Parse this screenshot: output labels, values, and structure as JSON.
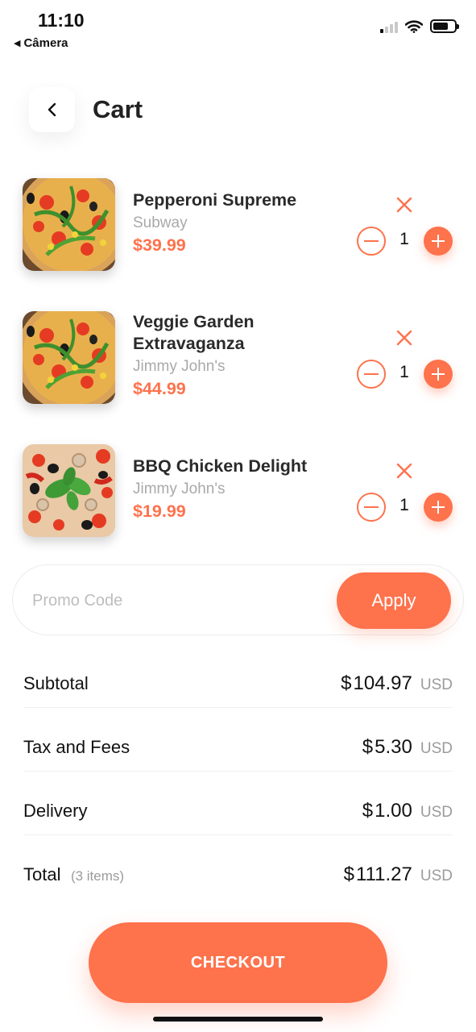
{
  "status_bar": {
    "time": "11:10",
    "back_app": "Câmera",
    "icons": [
      "cellular-signal",
      "wifi",
      "battery"
    ]
  },
  "header": {
    "back_icon": "chevron-left",
    "title": "Cart"
  },
  "items": [
    {
      "name": "Pepperoni Supreme",
      "store": "Subway",
      "price": "$39.99",
      "quantity": "1",
      "image": "pizza-arugula"
    },
    {
      "name": "Veggie Garden Extravaganza",
      "store": "Jimmy John's",
      "price": "$44.99",
      "quantity": "1",
      "image": "pizza-arugula"
    },
    {
      "name": "BBQ Chicken Delight",
      "store": "Jimmy John's",
      "price": "$19.99",
      "quantity": "1",
      "image": "pizza-basil"
    }
  ],
  "promo": {
    "placeholder": "Promo Code",
    "value": "",
    "apply_label": "Apply"
  },
  "summary": {
    "subtotal": {
      "label": "Subtotal",
      "currency": "$",
      "amount": "104.97",
      "unit": "USD"
    },
    "tax": {
      "label": "Tax and Fees",
      "currency": "$",
      "amount": "5.30",
      "unit": "USD"
    },
    "delivery": {
      "label": "Delivery",
      "currency": "$",
      "amount": "1.00",
      "unit": "USD"
    },
    "total": {
      "label": "Total",
      "note": "(3 items)",
      "currency": "$",
      "amount": "111.27",
      "unit": "USD"
    }
  },
  "checkout_label": "CHECKOUT",
  "colors": {
    "accent": "#FE724C",
    "text": "#1F1F1F",
    "muted": "#A9A9A9",
    "divider": "#F0F0F0"
  }
}
